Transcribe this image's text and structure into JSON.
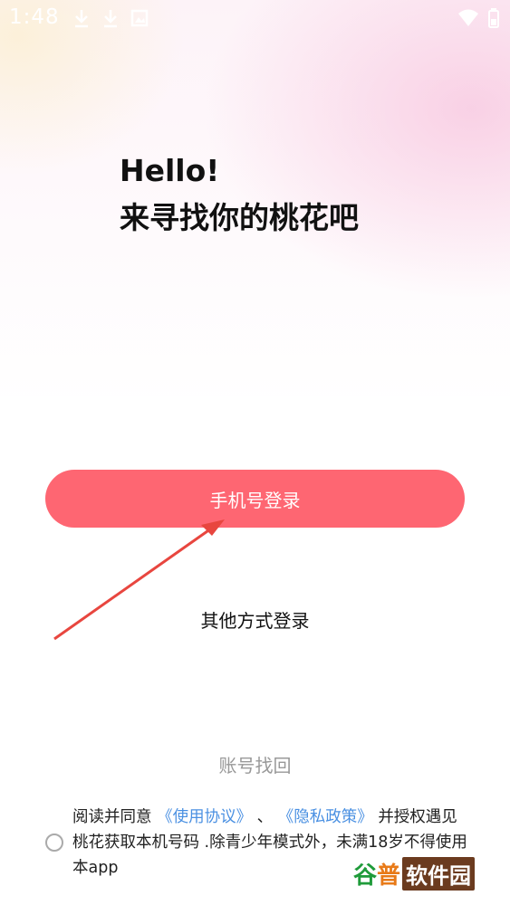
{
  "status_bar": {
    "time": "1:48",
    "icons": [
      "download-icon",
      "download-icon",
      "image-icon",
      "wifi-icon",
      "battery-icon"
    ]
  },
  "greeting": {
    "line1": "Hello!",
    "line2": "来寻找你的桃花吧"
  },
  "actions": {
    "phone_login": "手机号登录",
    "other_login": "其他方式登录",
    "account_recovery": "账号找回"
  },
  "agreement": {
    "prefix": "阅读并同意",
    "user_agreement": "《使用协议》",
    "separator": "、",
    "privacy_policy": "《隐私政策》",
    "suffix": "并授权遇见桃花获取本机号码 .除青少年模式外，未满18岁不得使用本app"
  },
  "watermark": {
    "part1": "谷",
    "part2": "普",
    "part3": "软件园"
  },
  "colors": {
    "accent": "#fe6672",
    "link": "#4a90e2",
    "arrow": "#e8463f"
  }
}
